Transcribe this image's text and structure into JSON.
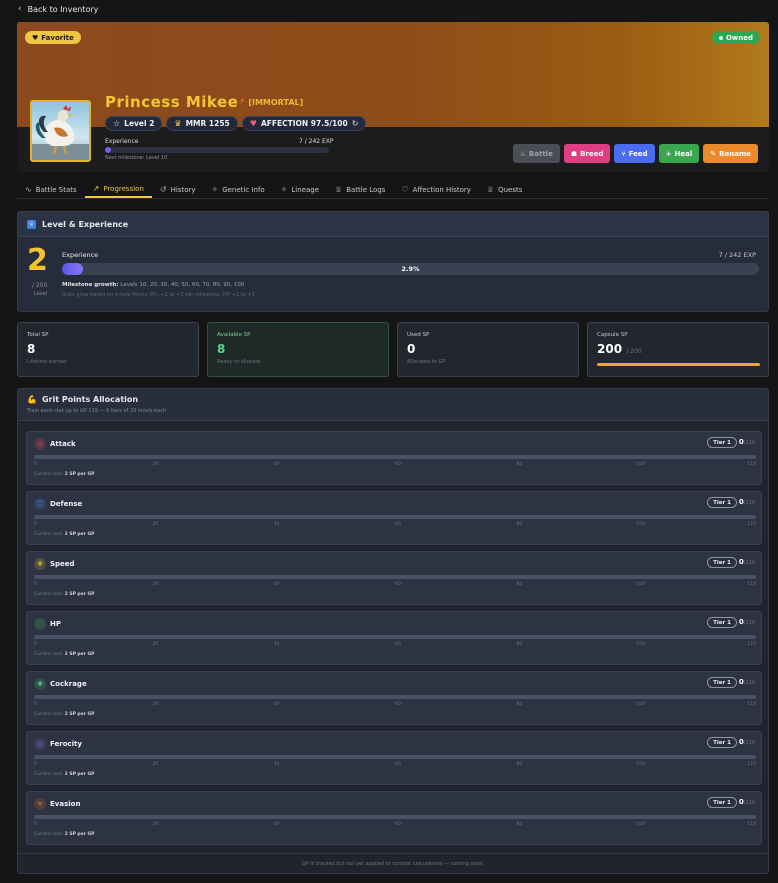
{
  "nav": {
    "back_label": "Back to Inventory"
  },
  "hero": {
    "favorite_label": "Favorite",
    "owned_label": "Owned",
    "name": "Princess Mikee",
    "rarity": "[IMMORTAL]",
    "badges": {
      "level": "Level 2",
      "mmr": "MMR 1255",
      "affection": "AFFECTION 97.5/100"
    },
    "experience_label": "Experience",
    "experience_value": "7 / 242 EXP",
    "experience_fraction": 0.029,
    "next_milestone": "Next milestone: Level 10",
    "actions": {
      "battle": "Battle",
      "breed": "Breed",
      "feed": "Feed",
      "heal": "Heal",
      "rename": "Rename"
    }
  },
  "tabs": [
    {
      "label": "Battle Stats",
      "icon": "pulse-icon"
    },
    {
      "label": "Progression",
      "icon": "trend-up-icon",
      "active": true
    },
    {
      "label": "History",
      "icon": "history-icon"
    },
    {
      "label": "Genetic Info",
      "icon": "sparkle-icon"
    },
    {
      "label": "Lineage",
      "icon": "sparkle-icon"
    },
    {
      "label": "Battle Logs",
      "icon": "trophy-icon"
    },
    {
      "label": "Affection History",
      "icon": "heart-icon"
    },
    {
      "label": "Quests",
      "icon": "trophy-icon"
    }
  ],
  "level_panel": {
    "title": "Level & Experience",
    "level": "2",
    "level_max": "/ 200",
    "level_label": "Level",
    "experience_label": "Experience",
    "experience_value": "7 / 242 EXP",
    "experience_percent": "2.9%",
    "experience_fraction": 0.029,
    "milestone_label": "Milestone growth:",
    "milestone_levels": "Levels 10, 20, 30, 40, 50, 60, 70, 80, 90, 100",
    "milestone_note": "Stats grow based on Innate Points (IP): +2 to +3 per milestone, IYP +2 to +5"
  },
  "sp_cards": {
    "total": {
      "title": "Total SP",
      "value": "8",
      "sub": "Lifetime earned"
    },
    "available": {
      "title": "Available SP",
      "value": "8",
      "sub": "Ready to allocate"
    },
    "used": {
      "title": "Used SP",
      "value": "0",
      "sub": "Allocated to GP"
    },
    "capsule": {
      "title": "Capsule SP",
      "value": "200",
      "max": "/ 200",
      "fraction": 1.0
    }
  },
  "gp_panel": {
    "title": "Grit Points Allocation",
    "subtitle": "Train each stat up to GP 119 — 6 tiers of 20 levels each",
    "ticks": [
      "0",
      "20",
      "40",
      "60",
      "80",
      "100",
      "119"
    ],
    "cost_label": "Current cost:",
    "cost_value": "2 SP per GP",
    "stats": [
      {
        "name": "Attack",
        "tier": "Tier 1",
        "value": "0",
        "max": "/119",
        "color": "#e0484f",
        "icon": "target-icon"
      },
      {
        "name": "Defense",
        "tier": "Tier 1",
        "value": "0",
        "max": "/119",
        "color": "#4f7de8",
        "icon": "shield-icon"
      },
      {
        "name": "Speed",
        "tier": "Tier 1",
        "value": "0",
        "max": "/119",
        "color": "#e2c03a",
        "icon": "move-icon"
      },
      {
        "name": "HP",
        "tier": "Tier 1",
        "value": "0",
        "max": "/119",
        "color": "#3fbf73",
        "icon": "heart-shield-icon"
      },
      {
        "name": "Cockrage",
        "tier": "Tier 1",
        "value": "0",
        "max": "/119",
        "color": "#4cc27b",
        "icon": "flame-icon"
      },
      {
        "name": "Ferocity",
        "tier": "Tier 1",
        "value": "0",
        "max": "/119",
        "color": "#8a63e6",
        "icon": "sword-icon"
      },
      {
        "name": "Evasion",
        "tier": "Tier 1",
        "value": "0",
        "max": "/119",
        "color": "#e0733a",
        "icon": "wind-icon"
      }
    ],
    "footer": "GP is tracked but not yet applied to combat calculations — coming soon."
  }
}
